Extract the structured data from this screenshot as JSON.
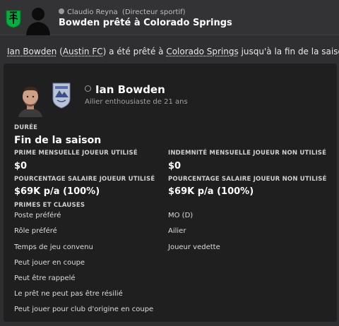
{
  "header": {
    "sender": "Claudio Reyna",
    "sender_role": "(Directeur sportif)",
    "subject": "Bowden prêté à Colorado Springs",
    "club_logo_icon": "austin-fc-logo",
    "sender_icon": "person-silhouette"
  },
  "intro": {
    "player_link": "Ian Bowden",
    "paren_open": " (",
    "club_link": "Austin FC",
    "mid_text": ") a été prêté à ",
    "dest_link": "Colorado Springs",
    "tail_text": " jusqu'à la fin de la saison."
  },
  "player": {
    "name": "Ian Bowden",
    "description": "Ailier enthousiaste de 21 ans",
    "face_icon": "player-face",
    "loan_club_icon": "colorado-springs-logo"
  },
  "duration": {
    "label": "DURÉE",
    "value": "Fin de la saison"
  },
  "fees": {
    "used_bonus_label": "PRIME MENSUELLE JOUEUR UTILISÉ",
    "used_bonus_value": "$0",
    "unused_fee_label": "INDEMNITÉ MENSUELLE JOUEUR NON UTILISÉ",
    "unused_fee_value": "$0",
    "used_wage_label": "POURCENTAGE SALAIRE JOUEUR UTILISÉ",
    "used_wage_value": "$69K p/a (100%)",
    "unused_wage_label": "POURCENTAGE SALAIRE JOUEUR NON UTILISÉ",
    "unused_wage_value": "$69K p/a (100%)"
  },
  "clauses": {
    "label": "PRIMES ET CLAUSES",
    "items": [
      {
        "label": "Poste préféré",
        "value": "MO (D)"
      },
      {
        "label": "Rôle préféré",
        "value": "Ailier"
      },
      {
        "label": "Temps de jeu convenu",
        "value": "Joueur vedette"
      },
      {
        "label": "Peut jouer en coupe",
        "value": ""
      },
      {
        "label": "Peut être rappelé",
        "value": ""
      },
      {
        "label": "Le prêt ne peut pas être résilié",
        "value": ""
      },
      {
        "label": "Peut jouer pour club d'origine en coupe",
        "value": ""
      }
    ]
  },
  "colors": {
    "background": "#2f2f31",
    "card": "#1f1f20",
    "austin_green": "#00b140"
  }
}
